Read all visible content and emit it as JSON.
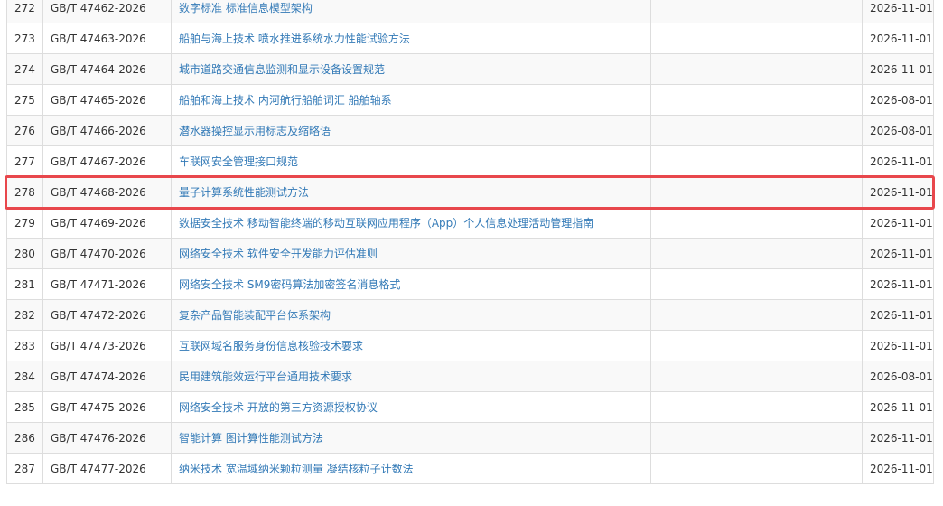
{
  "rows": [
    {
      "no": "272",
      "code": "GB/T 47462-2026",
      "title": "数字标准 标准信息模型架构",
      "replace": "",
      "date": "2026-11-01"
    },
    {
      "no": "273",
      "code": "GB/T 47463-2026",
      "title": "船舶与海上技术 喷水推进系统水力性能试验方法",
      "replace": "",
      "date": "2026-11-01"
    },
    {
      "no": "274",
      "code": "GB/T 47464-2026",
      "title": "城市道路交通信息监测和显示设备设置规范",
      "replace": "",
      "date": "2026-11-01"
    },
    {
      "no": "275",
      "code": "GB/T 47465-2026",
      "title": "船舶和海上技术 内河航行船舶词汇 船舶轴系",
      "replace": "",
      "date": "2026-08-01"
    },
    {
      "no": "276",
      "code": "GB/T 47466-2026",
      "title": "潜水器操控显示用标志及缩略语",
      "replace": "",
      "date": "2026-08-01"
    },
    {
      "no": "277",
      "code": "GB/T 47467-2026",
      "title": "车联网安全管理接口规范",
      "replace": "",
      "date": "2026-11-01"
    },
    {
      "no": "278",
      "code": "GB/T 47468-2026",
      "title": "量子计算系统性能测试方法",
      "replace": "",
      "date": "2026-11-01"
    },
    {
      "no": "279",
      "code": "GB/T 47469-2026",
      "title": "数据安全技术 移动智能终端的移动互联网应用程序（App）个人信息处理活动管理指南",
      "replace": "",
      "date": "2026-11-01"
    },
    {
      "no": "280",
      "code": "GB/T 47470-2026",
      "title": "网络安全技术 软件安全开发能力评估准则",
      "replace": "",
      "date": "2026-11-01"
    },
    {
      "no": "281",
      "code": "GB/T 47471-2026",
      "title": "网络安全技术 SM9密码算法加密签名消息格式",
      "replace": "",
      "date": "2026-11-01"
    },
    {
      "no": "282",
      "code": "GB/T 47472-2026",
      "title": "复杂产品智能装配平台体系架构",
      "replace": "",
      "date": "2026-11-01"
    },
    {
      "no": "283",
      "code": "GB/T 47473-2026",
      "title": "互联网域名服务身份信息核验技术要求",
      "replace": "",
      "date": "2026-11-01"
    },
    {
      "no": "284",
      "code": "GB/T 47474-2026",
      "title": "民用建筑能效运行平台通用技术要求",
      "replace": "",
      "date": "2026-08-01"
    },
    {
      "no": "285",
      "code": "GB/T 47475-2026",
      "title": "网络安全技术 开放的第三方资源授权协议",
      "replace": "",
      "date": "2026-11-01"
    },
    {
      "no": "286",
      "code": "GB/T 47476-2026",
      "title": "智能计算 图计算性能测试方法",
      "replace": "",
      "date": "2026-11-01"
    },
    {
      "no": "287",
      "code": "GB/T 47477-2026",
      "title": "纳米技术 宽温域纳米颗粒测量 凝结核粒子计数法",
      "replace": "",
      "date": "2026-11-01"
    }
  ],
  "highlight_row": "278",
  "colors": {
    "link": "#337ab7",
    "border": "#dddddd",
    "stripe": "#f9f9f9",
    "highlight": "#e8474c"
  }
}
